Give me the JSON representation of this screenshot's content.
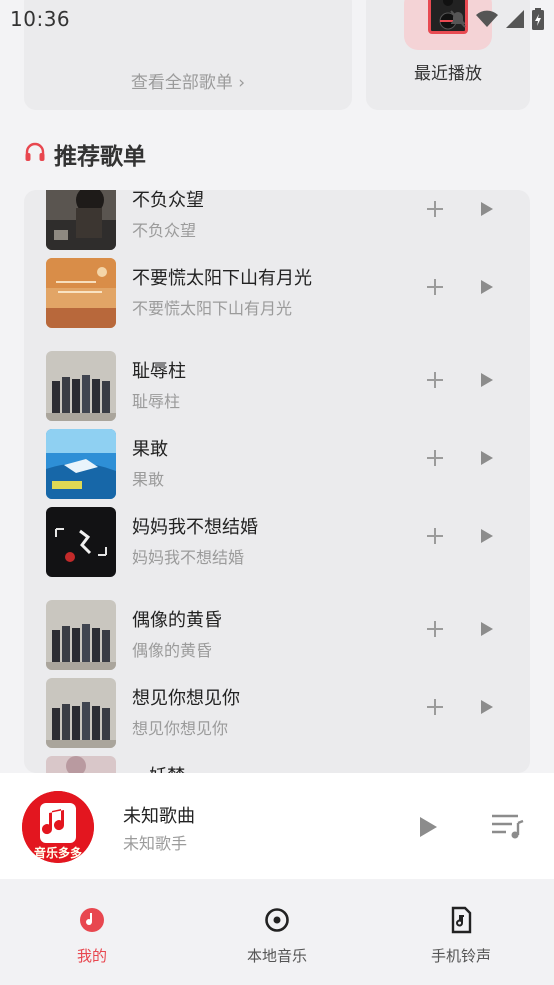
{
  "status_bar": {
    "time": "10:36"
  },
  "cards": {
    "all_playlists_link": "查看全部歌单 ›",
    "recent_label": "最近播放"
  },
  "section": {
    "title": "推荐歌单"
  },
  "playlists": [
    {
      "title": "不负众望",
      "subtitle": "不负众望"
    },
    {
      "title": "不要慌太阳下山有月光",
      "subtitle": "不要慌太阳下山有月光"
    },
    {
      "title": "耻辱柱",
      "subtitle": "耻辱柱"
    },
    {
      "title": "果敢",
      "subtitle": "果敢"
    },
    {
      "title": "妈妈我不想结婚",
      "subtitle": "妈妈我不想结婚"
    },
    {
      "title": "偶像的黄昏",
      "subtitle": "偶像的黄昏"
    },
    {
      "title": "想见你想见你",
      "subtitle": "想见你想见你"
    },
    {
      "title": "...妖梦",
      "subtitle": ""
    }
  ],
  "player": {
    "song": "未知歌曲",
    "artist": "未知歌手",
    "brand": "音乐多多"
  },
  "nav": {
    "tabs": [
      {
        "label": "我的"
      },
      {
        "label": "本地音乐"
      },
      {
        "label": "手机铃声"
      }
    ]
  },
  "colors": {
    "accent": "#e8474f",
    "panel": "#ebebed",
    "muted": "#9b9b9b"
  }
}
